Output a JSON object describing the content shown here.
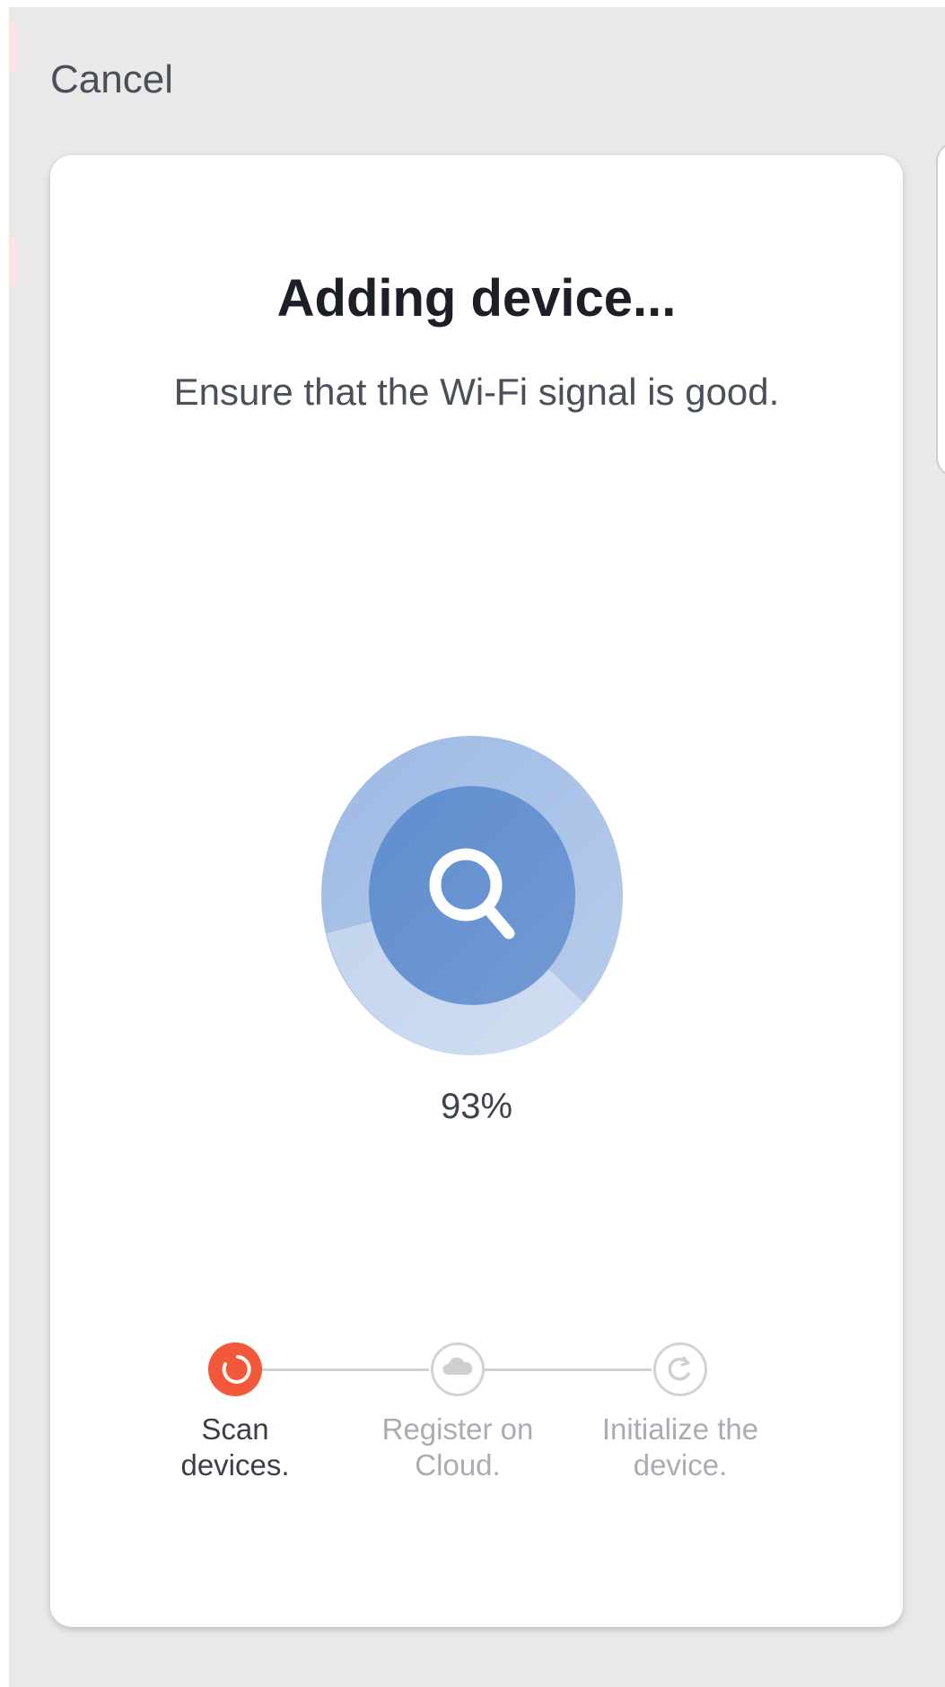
{
  "header": {
    "cancel_label": "Cancel"
  },
  "card": {
    "title": "Adding device...",
    "subtitle": "Ensure that the Wi-Fi signal is good.",
    "progress_percent": 93,
    "progress_text": "93%"
  },
  "steps": [
    {
      "line1": "Scan",
      "line2": "devices.",
      "state": "active",
      "icon": "loading-spinner-icon"
    },
    {
      "line1": "Register on",
      "line2": "Cloud.",
      "state": "pending",
      "icon": "cloud-icon"
    },
    {
      "line1": "Initialize the",
      "line2": "device.",
      "state": "pending",
      "icon": "refresh-icon"
    }
  ],
  "colors": {
    "background": "#e9e9e9",
    "card": "#ffffff",
    "accent_active": "#f2583a",
    "scan_outer": "#a4bfe6",
    "scan_inner": "#6593d0",
    "inactive": "#d3d3d3"
  }
}
